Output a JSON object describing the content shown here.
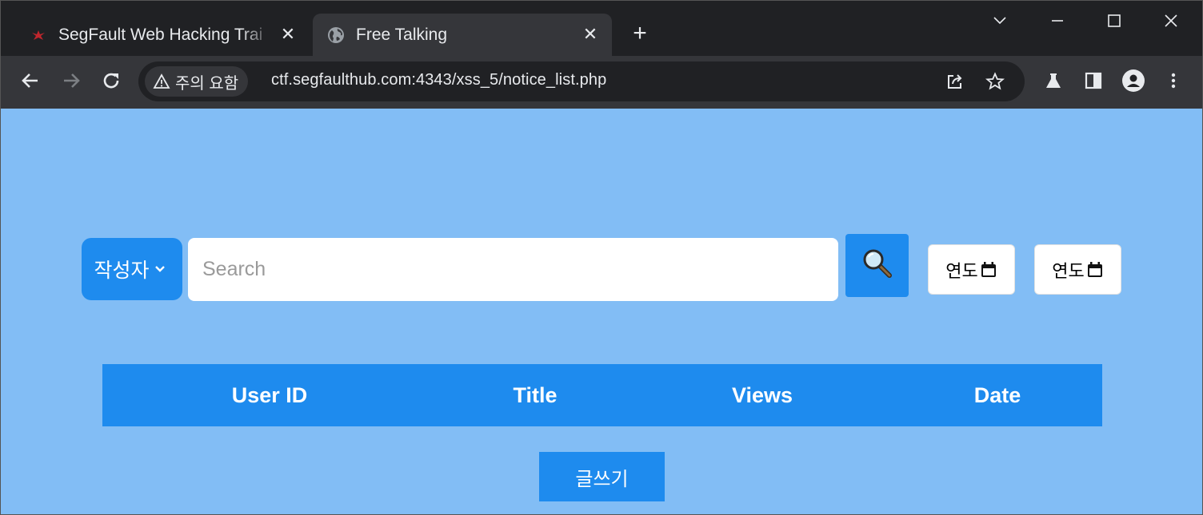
{
  "browser": {
    "tabs": [
      {
        "title": "SegFault Web Hacking Trai",
        "favicon": "segfault-logo-icon",
        "active": false
      },
      {
        "title": "Free Talking",
        "favicon": "globe-icon",
        "active": true
      }
    ],
    "tab_close_glyph": "✕",
    "new_tab_glyph": "+",
    "security_chip": "주의 요함",
    "url": "ctf.segfaulthub.com:4343/xss_5/notice_list.php"
  },
  "search_bar": {
    "select_value": "작성자",
    "placeholder": "Search",
    "date_from": "연도",
    "date_to": "연도"
  },
  "table": {
    "headers": [
      "User ID",
      "Title",
      "Views",
      "Date"
    ]
  },
  "write_button": "글쓰기",
  "colors": {
    "page_background": "#82bdf5",
    "accent": "#1e8bee"
  }
}
